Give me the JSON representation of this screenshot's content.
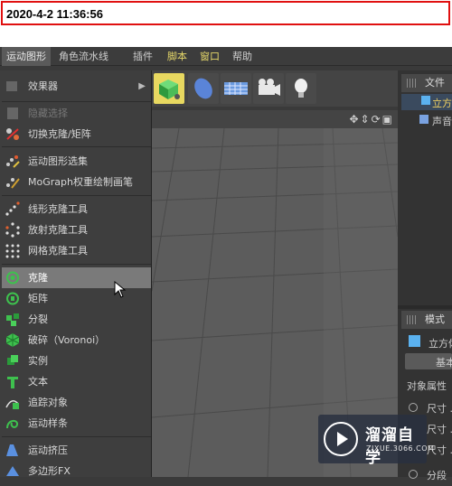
{
  "timestamp": "2020-4-2 11:36:56",
  "menubar": {
    "items": [
      "运动图形",
      "角色",
      "流水线",
      "插件",
      "脚本",
      "窗口",
      "帮助"
    ]
  },
  "menu": {
    "items": [
      {
        "label": "效果器",
        "icon": "effector-icon"
      },
      {
        "label": "隐藏选择",
        "icon": "hide-selection-icon"
      },
      {
        "label": "切换克隆/矩阵",
        "icon": "toggle-clone-icon"
      },
      {
        "label": "运动图形选集",
        "icon": "mograph-selection-icon"
      },
      {
        "label": "MoGraph权重绘制画笔",
        "icon": "weight-brush-icon"
      },
      {
        "label": "线形克隆工具",
        "icon": "linear-clone-icon"
      },
      {
        "label": "放射克隆工具",
        "icon": "radial-clone-icon"
      },
      {
        "label": "网格克隆工具",
        "icon": "grid-clone-icon"
      },
      {
        "label": "克隆",
        "icon": "cloner-icon"
      },
      {
        "label": "矩阵",
        "icon": "matrix-icon"
      },
      {
        "label": "分裂",
        "icon": "fracture-icon"
      },
      {
        "label": "破碎（Voronoi）",
        "icon": "voronoi-icon"
      },
      {
        "label": "实例",
        "icon": "instance-icon"
      },
      {
        "label": "文本",
        "icon": "text-icon"
      },
      {
        "label": "追踪对象",
        "icon": "tracer-icon"
      },
      {
        "label": "运动样条",
        "icon": "mospline-icon"
      },
      {
        "label": "运动挤压",
        "icon": "extrude-icon"
      },
      {
        "label": "多边形FX",
        "icon": "polyfx-icon"
      }
    ]
  },
  "rightpanel": {
    "tab_file": "文件",
    "obj1": "立方",
    "obj2": "声音",
    "mode_tab": "模式",
    "attr_obj": "立方体",
    "basic_btn": "基本",
    "section": "对象属性",
    "size1": "尺寸 .",
    "size2": "尺寸 .",
    "size3": "尺寸 .",
    "seg": "分段"
  },
  "watermark": {
    "title": "溜溜自学",
    "url": "ZIXUE.3066.COM"
  }
}
